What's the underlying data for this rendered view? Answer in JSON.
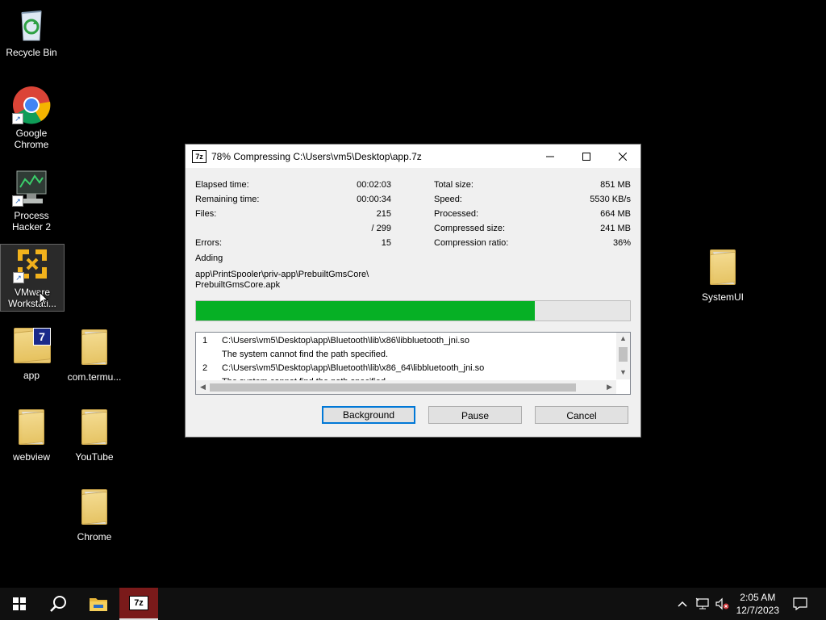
{
  "desktop": {
    "icons": [
      {
        "label": "Recycle Bin"
      },
      {
        "label": "Google\nChrome"
      },
      {
        "label": "Process\nHacker 2"
      },
      {
        "label": "VMware\nWorkstati..."
      },
      {
        "label": "app"
      },
      {
        "label": "com.termu..."
      },
      {
        "label": "webview"
      },
      {
        "label": "YouTube"
      },
      {
        "label": "Chrome"
      },
      {
        "label": "SystemUI"
      }
    ]
  },
  "dialog": {
    "app_icon": "7z",
    "title": "78% Compressing C:\\Users\\vm5\\Desktop\\app.7z",
    "elapsed_label": "Elapsed time:",
    "elapsed_value": "00:02:03",
    "remaining_label": "Remaining time:",
    "remaining_value": "00:00:34",
    "files_label": "Files:",
    "files_value": "215",
    "files_total": "/ 299",
    "errors_label": "Errors:",
    "errors_value": "15",
    "total_size_label": "Total size:",
    "total_size_value": "851 MB",
    "speed_label": "Speed:",
    "speed_value": "5530 KB/s",
    "processed_label": "Processed:",
    "processed_value": "664 MB",
    "compressed_label": "Compressed size:",
    "compressed_value": "241 MB",
    "ratio_label": "Compression ratio:",
    "ratio_value": "36%",
    "adding_label": "Adding",
    "current_path_1": "app\\PrintSpooler\\priv-app\\PrebuiltGmsCore\\",
    "current_path_2": "PrebuiltGmsCore.apk",
    "progress_percent": 78,
    "log": [
      {
        "num": "1",
        "path": "C:\\Users\\vm5\\Desktop\\app\\Bluetooth\\lib\\x86\\libbluetooth_jni.so",
        "msg": "The system cannot find the path specified."
      },
      {
        "num": "2",
        "path": "C:\\Users\\vm5\\Desktop\\app\\Bluetooth\\lib\\x86_64\\libbluetooth_jni.so",
        "msg": "The system cannot find the path specified."
      }
    ],
    "buttons": {
      "background": "Background",
      "pause": "Pause",
      "cancel": "Cancel"
    }
  },
  "taskbar": {
    "time": "2:05 AM",
    "date": "12/7/2023",
    "pinned_7z_label": "7z"
  },
  "colors": {
    "progress_fill": "#06b025",
    "default_button_border": "#0078d7"
  }
}
